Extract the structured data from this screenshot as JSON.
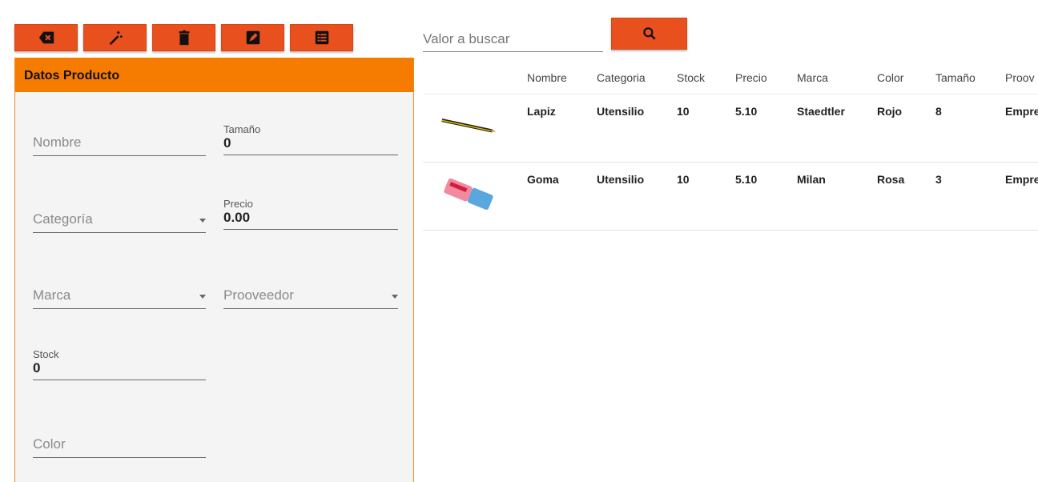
{
  "toolbar": {
    "buttons": [
      {
        "icon": "backspace-clear-icon"
      },
      {
        "icon": "magic-wand-icon"
      },
      {
        "icon": "trash-icon"
      },
      {
        "icon": "edit-icon"
      },
      {
        "icon": "list-icon"
      }
    ],
    "color": "#e8501e"
  },
  "form": {
    "title": "Datos Producto",
    "accent": "#f57c00",
    "nombre": {
      "placeholder": "Nombre"
    },
    "tamano": {
      "label": "Tamaño",
      "value": "0"
    },
    "categoria": {
      "placeholder": "Categoría"
    },
    "precio": {
      "label": "Precio",
      "value": "0.00"
    },
    "marca": {
      "placeholder": "Marca"
    },
    "prooveedor": {
      "placeholder": "Prooveedor"
    },
    "stock": {
      "label": "Stock",
      "value": "0"
    },
    "color": {
      "placeholder": "Color"
    }
  },
  "search": {
    "placeholder": "Valor a buscar",
    "button_icon": "search-icon"
  },
  "table": {
    "columns": [
      "",
      "Nombre",
      "Categoria",
      "Stock",
      "Precio",
      "Marca",
      "Color",
      "Tamaño",
      "Proov"
    ],
    "rows": [
      {
        "image": "pencil",
        "nombre": "Lapiz",
        "categoria": "Utensilio",
        "stock": "10",
        "precio": "5.10",
        "marca": "Staedtler",
        "color": "Rojo",
        "tamano": "8",
        "proveedor": "Empre"
      },
      {
        "image": "eraser",
        "nombre": "Goma",
        "categoria": "Utensilio",
        "stock": "10",
        "precio": "5.10",
        "marca": "Milan",
        "color": "Rosa",
        "tamano": "3",
        "proveedor": "Empre"
      }
    ]
  }
}
